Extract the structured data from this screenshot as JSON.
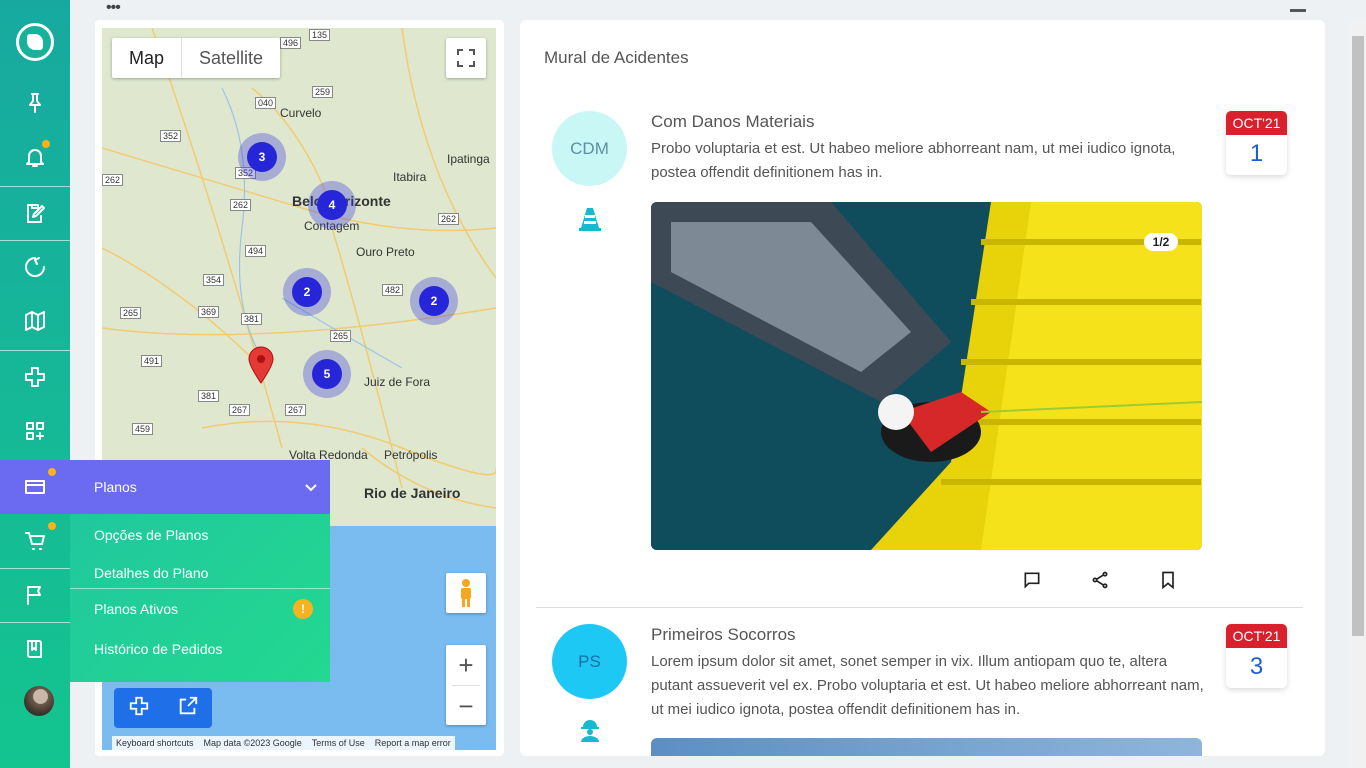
{
  "toolbar": {
    "dots": "•••"
  },
  "sidebar": {
    "items": [
      {
        "icon": "pin-icon"
      },
      {
        "icon": "bell-icon"
      },
      {
        "icon": "clipboard-edit-icon"
      },
      {
        "icon": "refresh-icon"
      },
      {
        "icon": "map-icon"
      },
      {
        "icon": "plus-cross-icon"
      },
      {
        "icon": "apps-add-icon"
      },
      {
        "icon": "credit-card-icon"
      },
      {
        "icon": "cart-icon"
      },
      {
        "icon": "flag-icon"
      },
      {
        "icon": "book-icon"
      }
    ],
    "notification_color": "#f9b21d"
  },
  "flyout": {
    "title": "Planos",
    "items": [
      "Opções de Planos",
      "Detalhes do Plano",
      "Planos Ativos",
      "Histórico de Pedidos"
    ],
    "badge": "!"
  },
  "map": {
    "type_buttons": [
      "Map",
      "Satellite"
    ],
    "clusters": [
      "3",
      "4",
      "2",
      "2",
      "5"
    ],
    "cities": [
      "Curvelo",
      "Ipatinga",
      "Itabira",
      "Belo Horizonte",
      "Contagem",
      "Ouro Preto",
      "Juiz de Fora",
      "Volta Redonda",
      "Petrópolis",
      "Rio de Janeiro"
    ],
    "roads": [
      "496",
      "135",
      "040",
      "259",
      "352",
      "352",
      "262",
      "262",
      "262",
      "494",
      "354",
      "482",
      "265",
      "369",
      "381",
      "265",
      "491",
      "381",
      "267",
      "267",
      "459"
    ],
    "attribution": [
      "Keyboard shortcuts",
      "Map data ©2023 Google",
      "Terms of Use",
      "Report a map error"
    ],
    "zoom_in": "+",
    "zoom_out": "−"
  },
  "feed": {
    "title": "Mural de Acidentes",
    "posts": [
      {
        "initials": "CDM",
        "title": "Com Danos Materiais",
        "text": "Probo voluptaria et est. Ut habeo meliore abhorreant nam, ut mei iudico ignota, postea offendit definitionem has in.",
        "month": "OCT'21",
        "day": "1",
        "counter": "1/2",
        "circle_color": "#c8f7f5"
      },
      {
        "initials": "PS",
        "title": "Primeiros Socorros",
        "text": "Lorem ipsum dolor sit amet, sonet semper in vix. Illum antiopam quo te, altera putant assueverit vel ex. Probo voluptaria et est. Ut habeo meliore abhorreant nam, ut mei iudico ignota, postea offendit definitionem has in.",
        "month": "OCT'21",
        "day": "3",
        "circle_color": "#1ec8f5"
      }
    ]
  }
}
